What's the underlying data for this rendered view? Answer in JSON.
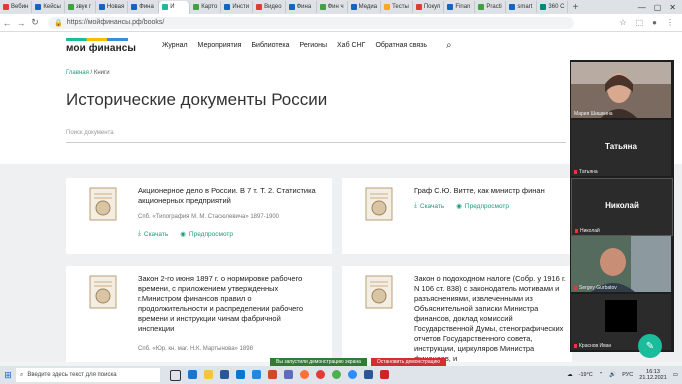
{
  "browser": {
    "tabs": [
      {
        "label": "Вебин",
        "color": "#e53935"
      },
      {
        "label": "Кейсы",
        "color": "#1565c0"
      },
      {
        "label": "звук г",
        "color": "#43a047"
      },
      {
        "label": "Новая",
        "color": "#1565c0"
      },
      {
        "label": "Фина",
        "color": "#1565c0"
      },
      {
        "label": "И",
        "color": "#1abc9c",
        "active": true
      },
      {
        "label": "Карто",
        "color": "#43a047"
      },
      {
        "label": "Инсти",
        "color": "#1565c0"
      },
      {
        "label": "Видео",
        "color": "#e53935"
      },
      {
        "label": "Фина",
        "color": "#1565c0"
      },
      {
        "label": "Фин ч",
        "color": "#43a047"
      },
      {
        "label": "Медиа",
        "color": "#1565c0"
      },
      {
        "label": "Тесты",
        "color": "#f9a825"
      },
      {
        "label": "Покуп",
        "color": "#e53935"
      },
      {
        "label": "Finan",
        "color": "#1565c0"
      },
      {
        "label": "Practi",
        "color": "#43a047"
      },
      {
        "label": "smart",
        "color": "#1565c0"
      },
      {
        "label": "360 С",
        "color": "#00897b"
      }
    ],
    "new_tab": "+",
    "url": "https://мойфинансы.рф/books/"
  },
  "site": {
    "logo": "мои финансы",
    "nav": [
      "Журнал",
      "Мероприятия",
      "Библиотека",
      "Регионы",
      "Хаб СНГ",
      "Обратная связь"
    ],
    "breadcrumb": {
      "home": "Главная",
      "sep": "/",
      "current": "Книги"
    },
    "title": "Исторические документы России",
    "search_placeholder": "Поиск документа",
    "download_label": "Скачать",
    "preview_label": "Предпросмотр",
    "cards": [
      {
        "title": "Акционерное дело в России. В 7 т. Т. 2. Статистика акционерных предприятий",
        "meta": "Спб. «Типография М. М. Стасюлевича» 1897-1900"
      },
      {
        "title": "Граф С.Ю. Витте, как министр финан",
        "meta": ""
      },
      {
        "title": "Закон 2-го июня 1897 г. о нормировке рабочего времени, с приложением утвержденных г.Министром финансов правил о продолжительности и распределении рабочего времени и инструкции чинам фабричной инспекции",
        "meta": "Спб. «Юр. кн. маг. Н.К. Мартынова» 1898"
      },
      {
        "title": "Закон о подоходном налоге (Собр. у 1916 г. N 106 ст. 838) с законодатель мотивами и разъяснениями, извлеченными из Объяснительной записки Министра финансов, доклад комиссий Государственной Думы, стенографических отчетов Государственного совета, инструкции, циркуляров Министра финансов, и",
        "meta": ""
      }
    ]
  },
  "zoom": {
    "participants": [
      {
        "label": "Мария Шишкина",
        "type": "video"
      },
      {
        "label": "Татьяна",
        "type": "name"
      },
      {
        "label": "Николай",
        "type": "name"
      },
      {
        "label": "Sergey Gurbatov",
        "type": "video"
      },
      {
        "label": "Краснов Иван",
        "type": "blank"
      }
    ],
    "share_status": "Вы запустили демонстрацию экрана",
    "stop_share": "Остановить демонстрацию"
  },
  "taskbar": {
    "search_placeholder": "Введите здесь текст для поиска",
    "weather": "-19°C",
    "lang": "РУС",
    "time": "16:13",
    "date": "21.12.2021"
  }
}
